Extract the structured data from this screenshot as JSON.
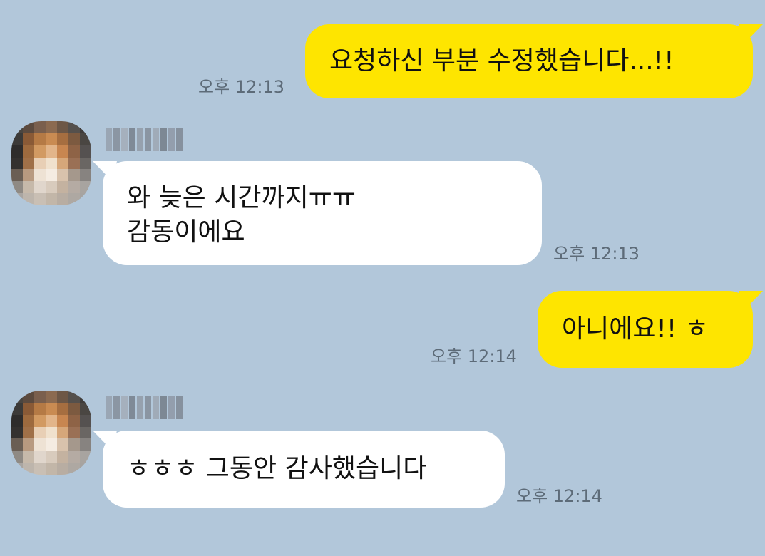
{
  "messages": [
    {
      "direction": "out",
      "lines": [
        "요청하신 부분 수정했습니다...!!"
      ],
      "time": "오후 12:13"
    },
    {
      "direction": "in",
      "sender_name_hidden": true,
      "lines": [
        "와 늦은 시간까지ㅠㅠ",
        "감동이에요"
      ],
      "time": "오후 12:13"
    },
    {
      "direction": "out",
      "lines": [
        "아니에요!! ㅎ"
      ],
      "time": "오후 12:14"
    },
    {
      "direction": "in",
      "sender_name_hidden": true,
      "lines": [
        "ㅎㅎㅎ 그동안 감사했습니다"
      ],
      "time": "오후 12:14"
    }
  ],
  "colors": {
    "background": "#b2c7da",
    "outgoing_bubble": "#fee500",
    "incoming_bubble": "#ffffff",
    "timestamp": "#5d6b78",
    "text": "#111111"
  },
  "icons": {
    "avatar": "blurred-dog-avatar",
    "sender_name": "pixelated-name"
  }
}
